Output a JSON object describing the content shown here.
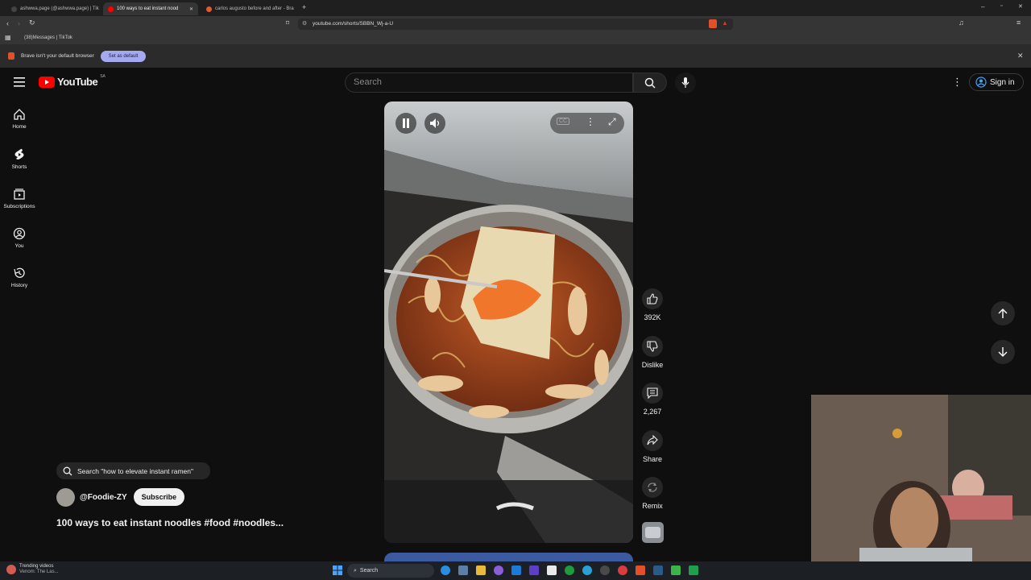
{
  "browser": {
    "tabs": [
      {
        "title": "ashwwa.page (@ashwwa.page) | Tik"
      },
      {
        "title": "100 ways to eat instant nood"
      },
      {
        "title": "carlos augusto before and after - Bra"
      }
    ],
    "url": "youtube.com/shorts/SBBN_Wj-a-U",
    "bookmark": "(38)Messages | TikTok",
    "infobar_text": "Brave isn't your default browser",
    "set_default_label": "Set as default"
  },
  "youtube": {
    "logo_text": "YouTube",
    "region": "SA",
    "search_placeholder": "Search",
    "signin_label": "Sign in",
    "nav": [
      {
        "label": "Home",
        "icon": "home-icon"
      },
      {
        "label": "Shorts",
        "icon": "shorts-icon"
      },
      {
        "label": "Subscriptions",
        "icon": "subscriptions-icon"
      },
      {
        "label": "You",
        "icon": "you-icon"
      },
      {
        "label": "History",
        "icon": "history-icon"
      }
    ],
    "actions": {
      "likes": "392K",
      "dislike": "Dislike",
      "comments": "2,267",
      "share": "Share",
      "remix": "Remix"
    },
    "suggest_search": "Search \"how to elevate instant ramen\"",
    "channel": "@Foodie-ZY",
    "subscribe_label": "Subscribe",
    "video_title": "100 ways to eat instant noodles #food #noodles..."
  },
  "taskbar": {
    "widget_title": "Trending videos",
    "widget_sub": "Venom: The Las...",
    "search_label": "Search"
  },
  "colors": {
    "background": "#0f0f0f",
    "youtube_red": "#ff0000",
    "set_default_bg": "#a5a9f0"
  }
}
